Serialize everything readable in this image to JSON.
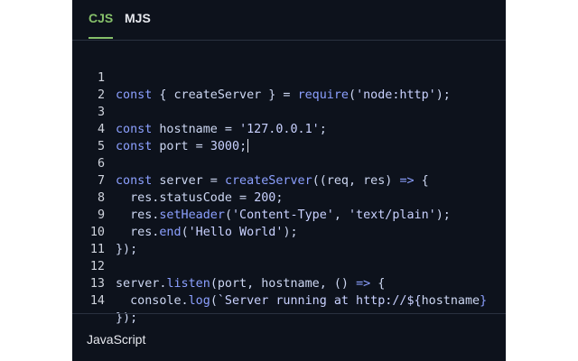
{
  "tabs": [
    "CJS",
    "MJS"
  ],
  "active_tab": "CJS",
  "language": "JavaScript",
  "colors": {
    "panel_bg": "#0d121c",
    "active_tab": "#86c06a",
    "keyword": "#8ca0ff"
  },
  "code": {
    "line_numbers": [
      "1",
      "2",
      "3",
      "4",
      "5",
      "6",
      "7",
      "8",
      "9",
      "10",
      "11",
      "12",
      "13",
      "14"
    ],
    "l1": [
      "const",
      " { createServer } = ",
      "require",
      "(",
      "'node:http'",
      ");"
    ],
    "l3": [
      "const",
      " hostname = ",
      "'127.0.0.1'",
      ";"
    ],
    "l4": [
      "const",
      " port = ",
      "3000",
      ";"
    ],
    "l6": [
      "const",
      " server = ",
      "createServer",
      "((req, res) ",
      "=>",
      " {"
    ],
    "l7": [
      "  res.statusCode = ",
      "200",
      ";"
    ],
    "l8": [
      "  res.",
      "setHeader",
      "(",
      "'Content-Type'",
      ", ",
      "'text/plain'",
      ");"
    ],
    "l9": [
      "  res.",
      "end",
      "(",
      "'Hello World'",
      ");"
    ],
    "l10": [
      "});"
    ],
    "l12": [
      "server.",
      "listen",
      "(port, hostname, () ",
      "=>",
      " {"
    ],
    "l13": [
      "  console.",
      "log",
      "(",
      "`Server running at http://${",
      "hostname",
      "}"
    ],
    "l14": [
      "});"
    ]
  }
}
